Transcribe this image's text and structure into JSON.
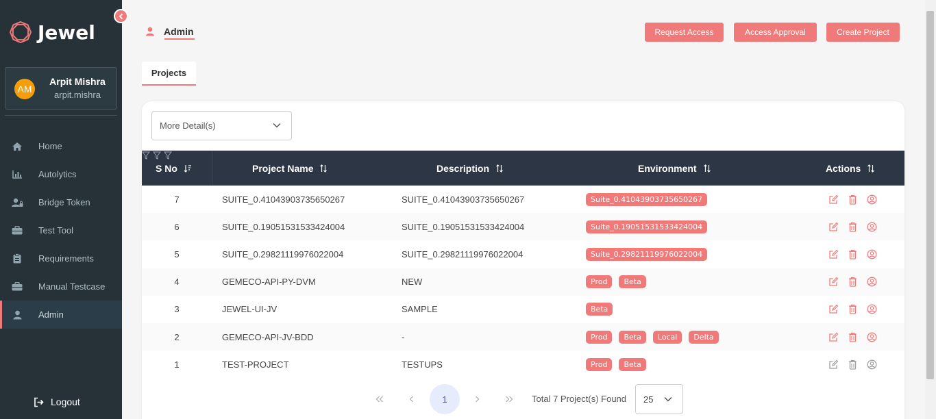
{
  "brand": {
    "name": "Jewel",
    "accent": "#f07a7a",
    "sidebar_bg": "#263238"
  },
  "user": {
    "initials": "AM",
    "name": "Arpit Mishra",
    "handle": "arpit.mishra"
  },
  "nav": [
    {
      "label": "Home",
      "icon": "home-icon"
    },
    {
      "label": "Autolytics",
      "icon": "bar-chart-icon"
    },
    {
      "label": "Bridge Token",
      "icon": "user-lock-icon"
    },
    {
      "label": "Test Tool",
      "icon": "toolbox-icon"
    },
    {
      "label": "Requirements",
      "icon": "clipboard-icon"
    },
    {
      "label": "Manual Testcase",
      "icon": "toolbox-icon"
    },
    {
      "label": "Admin",
      "icon": "user-icon",
      "active": true
    }
  ],
  "logout_label": "Logout",
  "header": {
    "tab_label": "Admin",
    "buttons": {
      "request_access": "Request Access",
      "access_approval": "Access Approval",
      "create_project": "Create Project"
    }
  },
  "tabs": {
    "projects": "Projects"
  },
  "details_dropdown": {
    "value": "More Detail(s)"
  },
  "table": {
    "columns": {
      "sno": "S No",
      "name": "Project Name",
      "description": "Description",
      "environment": "Environment",
      "actions": "Actions"
    },
    "rows": [
      {
        "sno": "7",
        "name": "SUITE_0.41043903735650267",
        "description": "SUITE_0.41043903735650267",
        "env": [
          "Suite_0.41043903735650267"
        ]
      },
      {
        "sno": "6",
        "name": "SUITE_0.19051531533424004",
        "description": "SUITE_0.19051531533424004",
        "env": [
          "Suite_0.19051531533424004"
        ]
      },
      {
        "sno": "5",
        "name": "SUITE_0.29821119976022004",
        "description": "SUITE_0.29821119976022004",
        "env": [
          "Suite_0.29821119976022004"
        ]
      },
      {
        "sno": "4",
        "name": "GEMECO-API-PY-DVM",
        "description": "NEW",
        "env": [
          "Prod",
          "Beta"
        ]
      },
      {
        "sno": "3",
        "name": "JEWEL-UI-JV",
        "description": "SAMPLE",
        "env": [
          "Beta"
        ]
      },
      {
        "sno": "2",
        "name": "GEMECO-API-JV-BDD",
        "description": "-",
        "env": [
          "Prod",
          "Beta",
          "Local",
          "Delta"
        ]
      },
      {
        "sno": "1",
        "name": "TEST-PROJECT",
        "description": "TESTUPS",
        "env": [
          "Prod",
          "Beta"
        ],
        "actions_disabled": true
      }
    ]
  },
  "pagination": {
    "current_page": "1",
    "total_text": "Total 7 Project(s) Found",
    "page_size": "25"
  }
}
